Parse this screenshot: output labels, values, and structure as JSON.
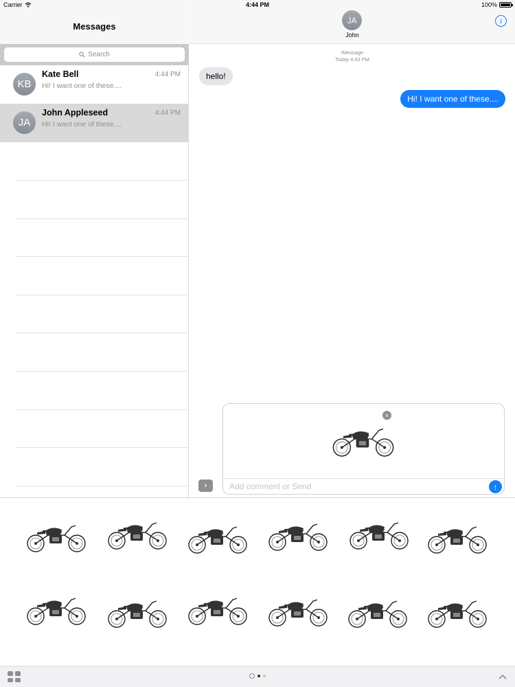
{
  "status": {
    "carrier": "Carrier",
    "time": "4:44 PM",
    "battery": "100%"
  },
  "sidebar": {
    "title": "Messages",
    "search_placeholder": "Search",
    "conversations": [
      {
        "initials": "KB",
        "name": "Kate Bell",
        "time": "4:44 PM",
        "preview": "Hi! I want one of these....",
        "selected": false
      },
      {
        "initials": "JA",
        "name": "John Appleseed",
        "time": "4:44 PM",
        "preview": "Hi! I want one of these....",
        "selected": true
      }
    ]
  },
  "chat": {
    "contact_initials": "JA",
    "contact_name": "John",
    "service": "iMessage",
    "timestamp": "Today 4:43 PM",
    "messages": [
      {
        "direction": "in",
        "text": "hello!"
      },
      {
        "direction": "out",
        "text": "Hi! I want one of these...."
      }
    ],
    "compose": {
      "placeholder": "Add comment or Send",
      "attachment": "motorcycle-sticker"
    }
  },
  "tray": {
    "stickers_count": 12,
    "page_dots": 2,
    "active_page": 0
  },
  "colors": {
    "accent": "#147efb",
    "incoming_bubble": "#e5e5ea",
    "selected_row": "#d9d9d9"
  }
}
